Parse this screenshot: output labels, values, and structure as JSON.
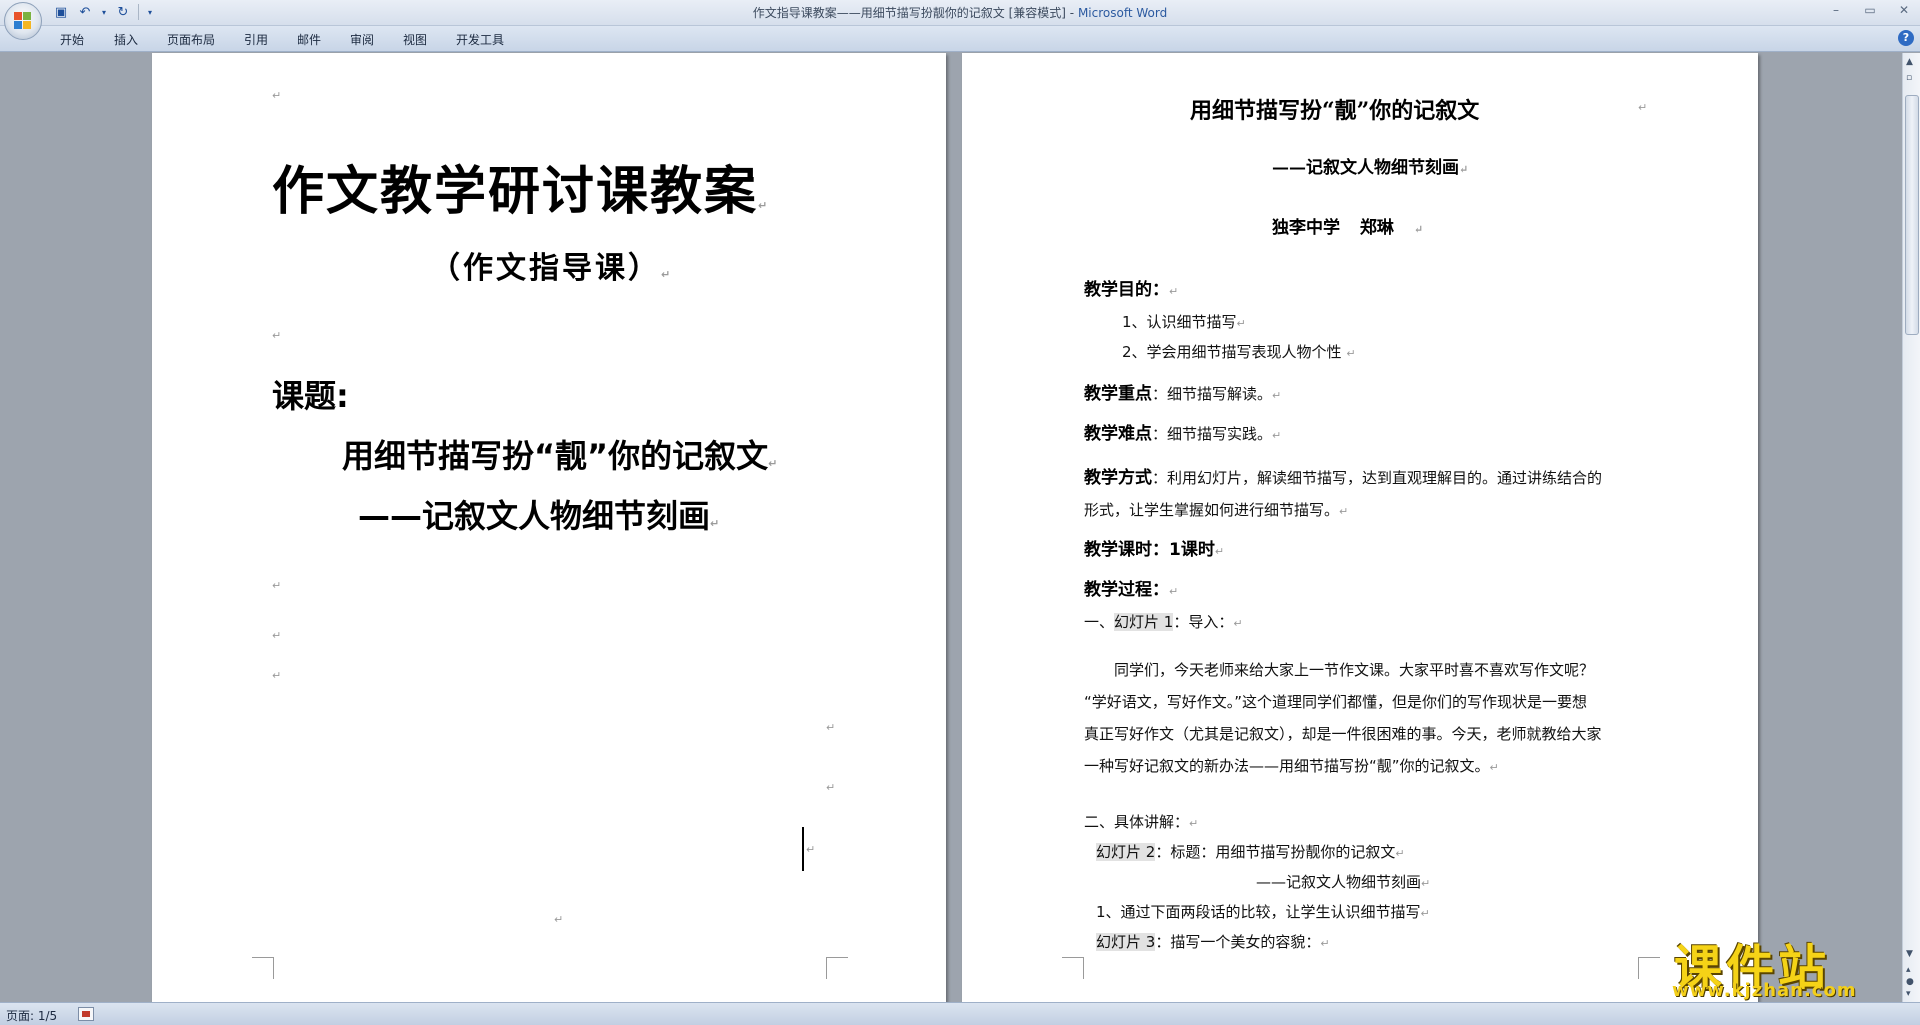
{
  "window": {
    "title_doc": "作文指导课教案——用细节描写扮靓你的记叙文 [兼容模式]",
    "title_sep": " - ",
    "title_app": "Microsoft Word"
  },
  "ribbon": {
    "tabs": [
      "开始",
      "插入",
      "页面布局",
      "引用",
      "邮件",
      "审阅",
      "视图",
      "开发工具"
    ]
  },
  "page1": {
    "title": "作文教学研讨课教案",
    "subtitle": "（作文指导课）",
    "topic_label": "课题:",
    "topic_line1": "用细节描写扮“靓”你的记叙文",
    "topic_line2": "——记叙文人物细节刻画"
  },
  "page2": {
    "title": "用细节描写扮“靓”你的记叙文",
    "subtitle": "——记叙文人物细节刻画",
    "school": "独李中学",
    "author": "郑琳",
    "goal_label": "教学目的",
    "goal_colon": "：",
    "goal_1": "1、认识细节描写",
    "goal_2": "2、学会用细节描写表现人物个性",
    "key_label": "教学重点",
    "key_text": "：细节描写解读。",
    "diff_label": "教学难点",
    "diff_text": "：细节描写实践。",
    "method_label": "教学方式",
    "method_text1": "：利用幻灯片，解读细节描写，达到直观理解目的。通过讲练结合的",
    "method_text2": "形式，让学生掌握如何进行细节描写。",
    "hours": "教学课时：1课时",
    "process": "教学过程：",
    "sec1_prefix": "一、",
    "sec1_slide": "幻灯片 1",
    "sec1_text": "：导入：",
    "para1": "同学们，今天老师来给大家上一节作文课。大家平时喜不喜欢写作文呢？",
    "para2": "“学好语文，写好作文。”这个道理同学们都懂，但是你们的写作现状是一要想",
    "para3": "真正写好作文（尤其是记叙文），却是一件很困难的事。今天，老师就教给大家",
    "para4": "一种写好记叙文的新办法——用细节描写扮“靓”你的记叙文。",
    "sec2": "二、具体讲解：",
    "slide2": "幻灯片 2",
    "slide2_text": "：标题：用细节描写扮靓你的记叙文",
    "slide2_sub": "——记叙文人物细节刻画",
    "item1": "1、通过下面两段话的比较，让学生认识细节描写",
    "slide3": "幻灯片 3",
    "slide3_text": "：描写一个美女的容貌："
  },
  "status": {
    "page": "页面: 1/5"
  },
  "watermark": {
    "brand": "课件站",
    "url": "www.kjzhan.com"
  },
  "marks": {
    "para": "↵"
  },
  "colors": {
    "highlight": "#e2e2e2",
    "word_blue": "#2c5aa0",
    "watermark": "#f5d317"
  },
  "icons": [
    "office-button-icon",
    "save-icon",
    "undo-icon",
    "redo-icon",
    "help-icon",
    "spell-check-icon"
  ]
}
